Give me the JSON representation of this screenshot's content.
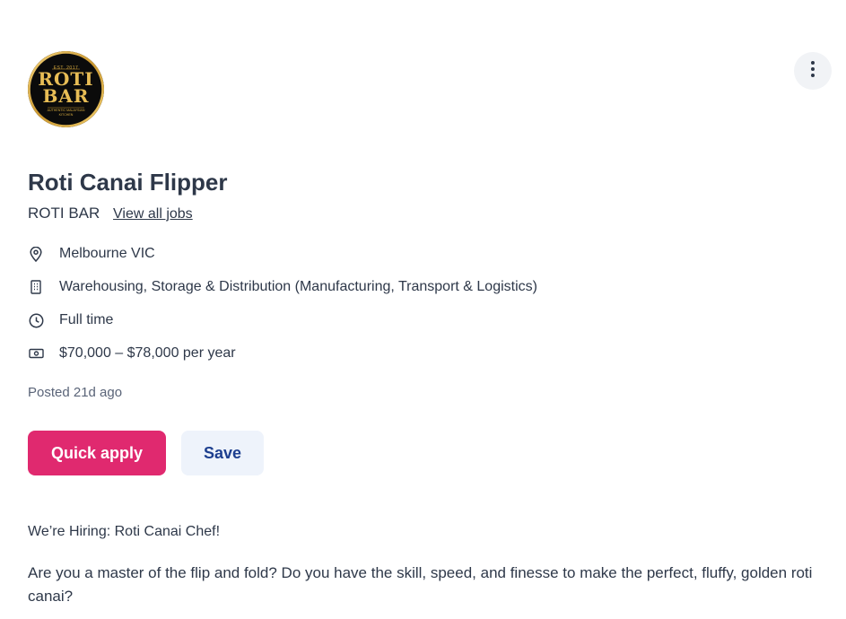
{
  "logo": {
    "brand": "ROTI BAR",
    "tagline_top": "EST. 2017",
    "tagline_bottom": "AUTHENTIC MALAYSIAN KITCHEN"
  },
  "job": {
    "title": "Roti Canai Flipper",
    "company": "ROTI BAR",
    "view_all_jobs": "View all jobs",
    "details": {
      "location": {
        "icon": "location-pin-icon",
        "text": "Melbourne VIC"
      },
      "category": {
        "icon": "building-icon",
        "text": "Warehousing, Storage & Distribution (Manufacturing, Transport & Logistics)"
      },
      "work_type": {
        "icon": "clock-icon",
        "text": "Full time"
      },
      "salary": {
        "icon": "money-icon",
        "text": "$70,000 – $78,000 per year"
      }
    },
    "posted": "Posted 21d ago"
  },
  "actions": {
    "quick_apply": "Quick apply",
    "save": "Save",
    "more_icon": "more-vertical-icon"
  },
  "description": {
    "heading": "We’re Hiring: Roti Canai Chef!",
    "intro": "Are you a master of the flip and fold? Do you have the skill, speed, and finesse to make the perfect, fluffy, golden roti canai?"
  },
  "colors": {
    "primary": "#e0296f",
    "save_bg": "#eef3fb",
    "save_text": "#1d3f8f",
    "text": "#2e3849",
    "logo_gold": "#d4a93f"
  }
}
